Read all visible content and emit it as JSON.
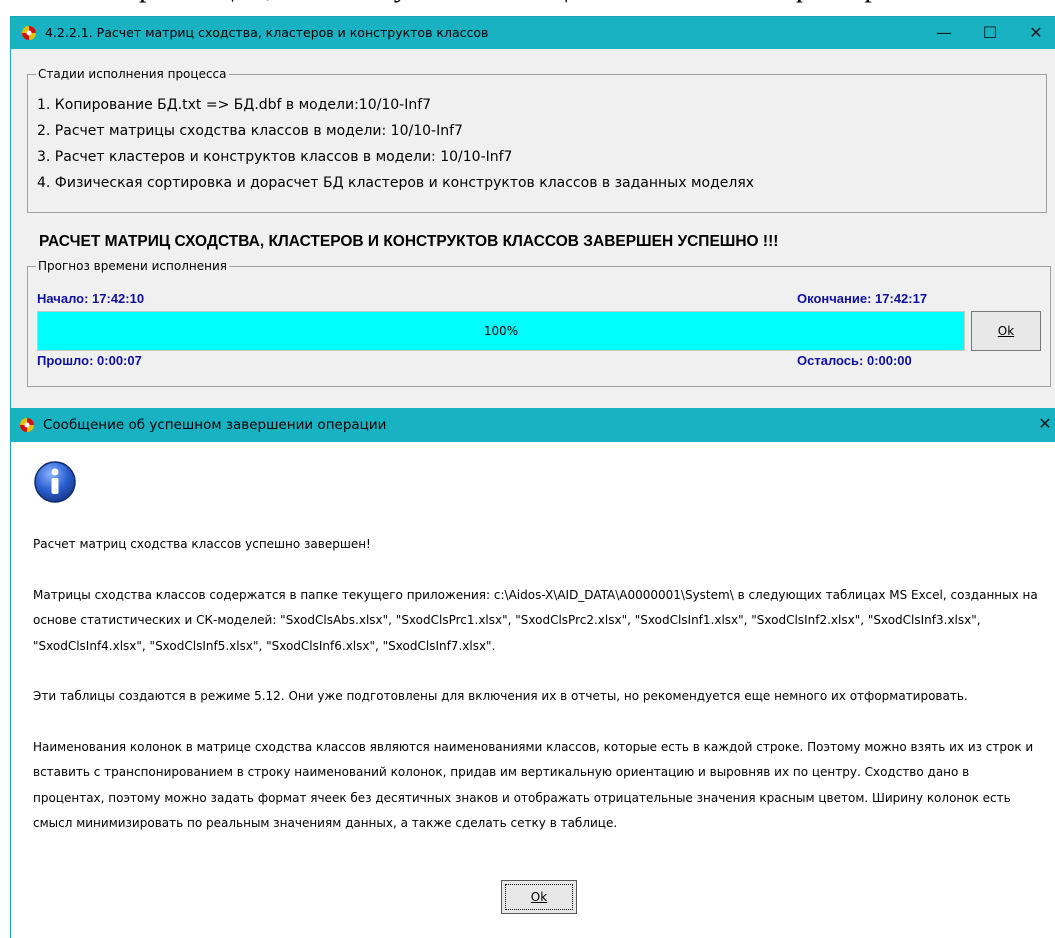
{
  "background_text": "рминации, т.е. не обуславливающим их значениям факторов.",
  "main_window": {
    "title": "4.2.2.1. Расчет матриц сходства, кластеров и конструктов классов",
    "controls": {
      "minimize": "—",
      "maximize": "☐",
      "close": "✕"
    },
    "stages": {
      "legend": "Стадии исполнения процесса",
      "items": [
        "1. Копирование БД.txt => БД.dbf в модели:10/10-Inf7",
        "2. Расчет матрицы сходства классов в модели: 10/10-Inf7",
        "3. Расчет кластеров и конструктов классов в модели: 10/10-Inf7",
        "4. Физическая сортировка и дорасчет БД кластеров и конструктов классов в заданных моделях"
      ]
    },
    "success_message": "РАСЧЕТ МАТРИЦ СХОДСТВА, КЛАСТЕРОВ И КОНСТРУКТОВ КЛАССОВ ЗАВЕРШЕН УСПЕШНО !!!",
    "forecast": {
      "legend": "Прогноз времени исполнения",
      "start": "Начало: 17:42:10",
      "end": "Окончание: 17:42:17",
      "elapsed": "Прошло: 0:00:07",
      "remaining": "Осталось: 0:00:00",
      "progress_value": 1.0,
      "progress_label": "100%",
      "progress_color": "#00ffff"
    },
    "ok_label": "Ok"
  },
  "dialog": {
    "title": "Сообщение об успешном завершении операции",
    "close": "✕",
    "icon": "info-icon",
    "paragraphs": [
      "Расчет матриц сходства классов успешно завершен!",
      "Матрицы сходства классов содержатся в папке текущего приложения: c:\\Aidos-X\\AID_DATA\\A0000001\\System\\ в следующих таблицах MS Excel, созданных на основе статистических и СК-моделей: \"SxodClsAbs.xlsx\", \"SxodClsPrc1.xlsx\", \"SxodClsPrc2.xlsx\", \"SxodClsInf1.xlsx\", \"SxodClsInf2.xlsx\", \"SxodClsInf3.xlsx\", \"SxodClsInf4.xlsx\", \"SxodClsInf5.xlsx\", \"SxodClsInf6.xlsx\", \"SxodClsInf7.xlsx\".",
      "Эти таблицы создаются в режиме 5.12. Они уже подготовлены для включения их в отчеты, но рекомендуется еще немного их отформатировать.",
      "Наименования колонок в матрице сходства классов являются наименованиями классов, которые есть в каждой строке. Поэтому можно взять их из строк и вставить с транспонированием в строку наименований колонок, придав им вертикальную ориентацию и выровняв их по центру. Сходство дано в процентах, поэтому можно задать формат ячеек без десятичных знаков и отображать отрицательные значения красным цветом. Ширину колонок есть смысл минимизировать по реальным значениям данных, а также сделать сетку в таблице."
    ],
    "ok_label": "Ok"
  },
  "colors": {
    "titlebar": "#19b2c2",
    "accent_text": "#1010a0"
  }
}
